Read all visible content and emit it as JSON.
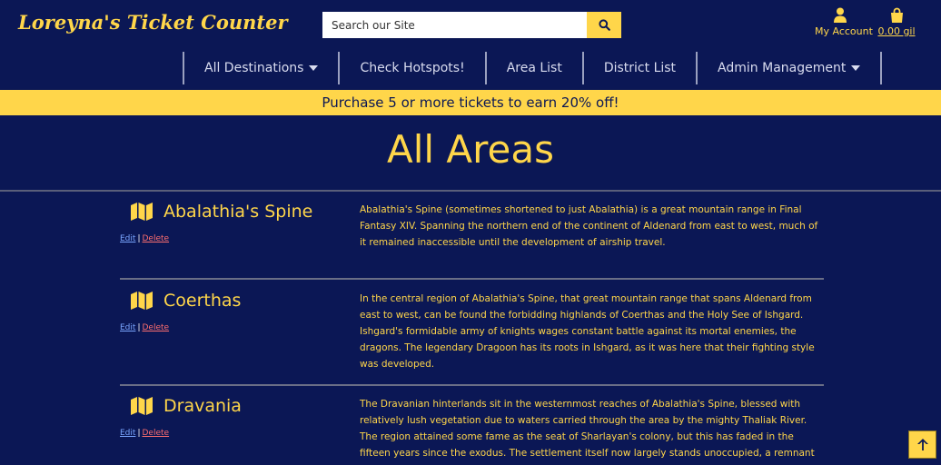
{
  "header": {
    "brand": "Loreyna's Ticket Counter",
    "search_placeholder": "Search our Site",
    "account_label": "My Account",
    "cart_label": "0.00 gil"
  },
  "nav": {
    "items": [
      {
        "label": "All Destinations",
        "dropdown": true
      },
      {
        "label": "Check Hotspots!",
        "dropdown": false
      },
      {
        "label": "Area List",
        "dropdown": false
      },
      {
        "label": "District List",
        "dropdown": false
      },
      {
        "label": "Admin Management",
        "dropdown": true
      }
    ]
  },
  "promo": "Purchase 5 or more tickets to earn 20% off!",
  "page_title": "All Areas",
  "areas": [
    {
      "name": "Abalathia's Spine",
      "edit": "Edit",
      "delete": "Delete",
      "description": "Abalathia's Spine (sometimes shortened to just Abalathia) is a great mountain range in Final Fantasy XIV. Spanning the northern end of the continent of Aldenard from east to west, much of it remained inaccessible until the development of airship travel."
    },
    {
      "name": "Coerthas",
      "edit": "Edit",
      "delete": "Delete",
      "description": "In the central region of Abalathia's Spine, that great mountain range that spans Aldenard from east to west, can be found the forbidding highlands of Coerthas and the Holy See of Ishgard. Ishgard's formidable army of knights wages constant battle against its mortal enemies, the dragons. The legendary Dragoon has its roots in Ishgard, as it was here that their fighting style was developed."
    },
    {
      "name": "Dravania",
      "edit": "Edit",
      "delete": "Delete",
      "description": "The Dravanian hinterlands sit in the westernmost reaches of Abalathia's Spine, blessed with relatively lush vegetation due to waters carried through the area by the mighty Thaliak River. The region attained some fame as the seat of Sharlayan's colony, but this has faded in the fifteen years since the exodus. The settlement itself now largely stands unoccupied, a remnant of a lost time slowly being reclaimed by the land."
    }
  ],
  "colors": {
    "background": "#0b1755",
    "accent": "#ffd64a",
    "link": "#7aa6ff",
    "delete": "#ff6f6f"
  },
  "icons": {
    "search": "search-icon",
    "account": "user-icon",
    "cart": "shopping-bag-icon",
    "area": "map-icon",
    "scroll_top": "arrow-up-icon"
  }
}
